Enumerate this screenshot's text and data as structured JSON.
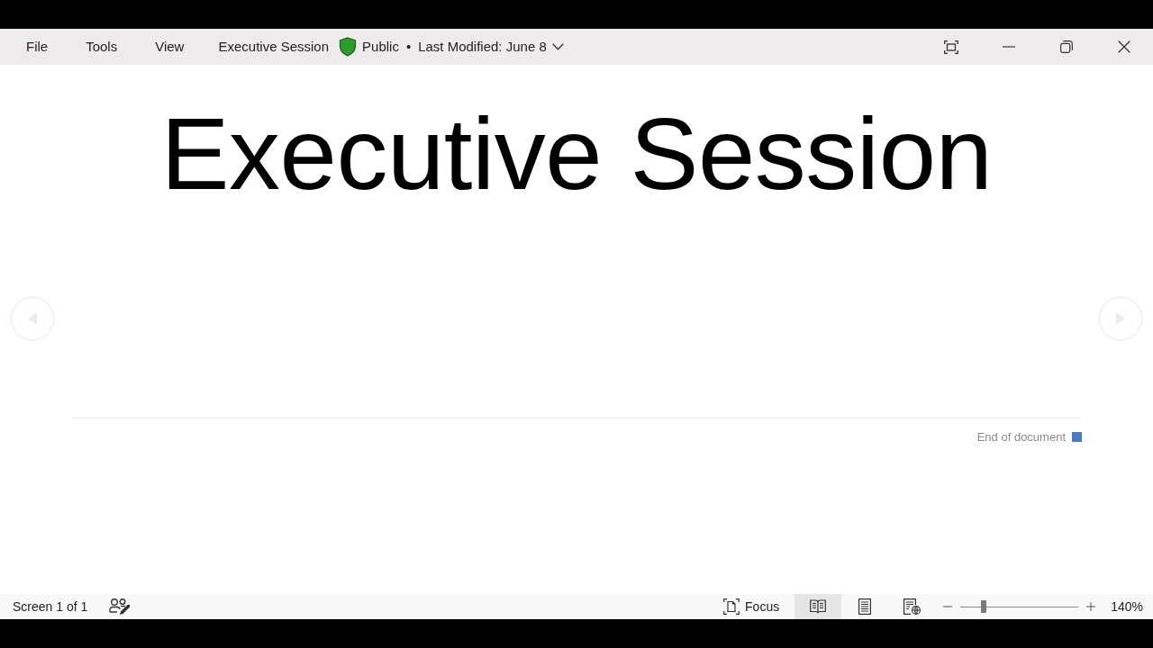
{
  "menu": [
    "File",
    "Tools",
    "View"
  ],
  "document": {
    "name": "Executive Session",
    "label": "Public",
    "separator": "•",
    "modified": "Last Modified: June 8"
  },
  "page": {
    "title": "Executive Session",
    "end_text": "End of document"
  },
  "status_bar": {
    "screen": "Screen 1 of 1",
    "focus": "Focus",
    "views": [
      {
        "kind": "read",
        "selected": true
      },
      {
        "kind": "print",
        "selected": false
      },
      {
        "kind": "web",
        "selected": false
      }
    ],
    "zoom": {
      "level": 0.2,
      "reading": "140%"
    }
  }
}
